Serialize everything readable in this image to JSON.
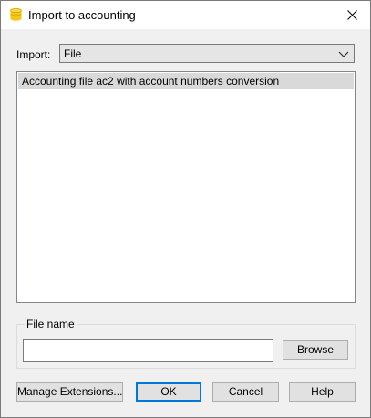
{
  "window": {
    "title": "Import to accounting",
    "app_icon": "database-cylinder-icon",
    "close_icon": "close-icon"
  },
  "import": {
    "label": "Import:",
    "selected": "File",
    "dropdown_icon": "chevron-down-icon"
  },
  "list": {
    "items": [
      {
        "label": "Accounting file ac2 with account numbers conversion",
        "selected": true
      }
    ]
  },
  "file_group": {
    "title": "File name",
    "input_value": "",
    "browse_label": "Browse"
  },
  "buttons": {
    "manage_extensions": "Manage Extensions...",
    "ok": "OK",
    "cancel": "Cancel",
    "help": "Help"
  },
  "colors": {
    "app_icon": "#f5c518",
    "selected_item_bg": "#d9d9d9",
    "default_button_border": "#0078d7",
    "dialog_bg": "#f0f0f0"
  }
}
